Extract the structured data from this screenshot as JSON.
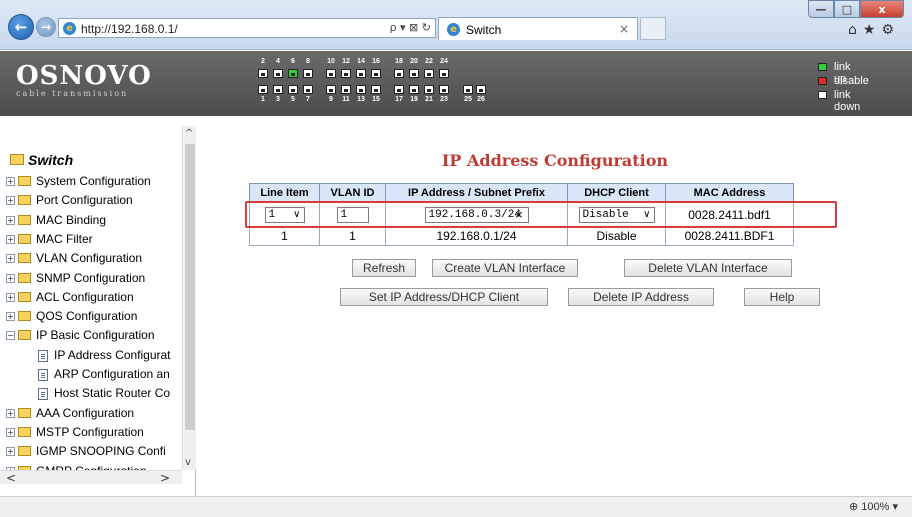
{
  "browser": {
    "url": "http://192.168.0.1/",
    "addr_tools": "ρ ▾ ⊠ ↻",
    "tab_title": "Switch",
    "tab_close": "×",
    "back": "←",
    "forward": "→",
    "minimize": "—",
    "maximize": "□",
    "close": "x",
    "right_icons": "⌂★⚙"
  },
  "banner": {
    "logo": "OSNOVO",
    "logo_sub": "cable transmission",
    "ports_top": [
      "2",
      "4",
      "6",
      "8",
      "10",
      "12",
      "14",
      "16",
      "18",
      "20",
      "22",
      "24"
    ],
    "ports_bottom": [
      "1",
      "3",
      "5",
      "7",
      "9",
      "11",
      "13",
      "15",
      "17",
      "19",
      "21",
      "23",
      "25",
      "26"
    ],
    "port_up": "6",
    "legend": [
      {
        "label": "link up",
        "color": "#2fd13a"
      },
      {
        "label": "disable",
        "color": "#e02b2b"
      },
      {
        "label": "link down",
        "color": "#ffffff"
      }
    ]
  },
  "sidebar": {
    "root": "Switch",
    "items": [
      {
        "label": "System Configuration",
        "expander": "+"
      },
      {
        "label": "Port Configuration",
        "expander": "+"
      },
      {
        "label": "MAC Binding",
        "expander": "+"
      },
      {
        "label": "MAC Filter",
        "expander": "+"
      },
      {
        "label": "VLAN Configuration",
        "expander": "+"
      },
      {
        "label": "SNMP Configuration",
        "expander": "+"
      },
      {
        "label": "ACL Configuration",
        "expander": "+"
      },
      {
        "label": "QOS Configuration",
        "expander": "+"
      },
      {
        "label": "IP Basic Configuration",
        "expander": "−"
      },
      {
        "label": "AAA Configuration",
        "expander": "+"
      },
      {
        "label": "MSTP Configuration",
        "expander": "+"
      },
      {
        "label": "IGMP SNOOPING Confi",
        "expander": "+"
      },
      {
        "label": "GMRP Configuration",
        "expander": "+"
      }
    ],
    "children": [
      {
        "label": "IP Address Configurat"
      },
      {
        "label": "ARP Configuration an"
      },
      {
        "label": "Host Static Router Co"
      }
    ],
    "scroll_up": "^",
    "scroll_down": "v",
    "scroll_left": "<",
    "scroll_right": ">"
  },
  "main": {
    "title": "IP Address Configuration",
    "columns": [
      "Line Item",
      "VLAN ID",
      "IP Address / Subnet Prefix",
      "DHCP Client",
      "MAC Address"
    ],
    "edit_row": {
      "line_item": "1",
      "vlan_id": "1",
      "ip": "192.168.0.3/24",
      "ip_clear": "×",
      "dhcp": "Disable",
      "mac": "0028.2411.bdf1",
      "chevron": "∨"
    },
    "rows": [
      {
        "line_item": "1",
        "vlan_id": "1",
        "ip": "192.168.0.1/24",
        "dhcp": "Disable",
        "mac": "0028.2411.BDF1"
      }
    ],
    "buttons": {
      "refresh": "Refresh",
      "create_vlan": "Create VLAN Interface",
      "delete_vlan": "Delete VLAN Interface",
      "set_ip": "Set IP Address/DHCP Client",
      "delete_ip": "Delete IP Address",
      "help": "Help"
    }
  },
  "status": {
    "zoom": "100%"
  }
}
